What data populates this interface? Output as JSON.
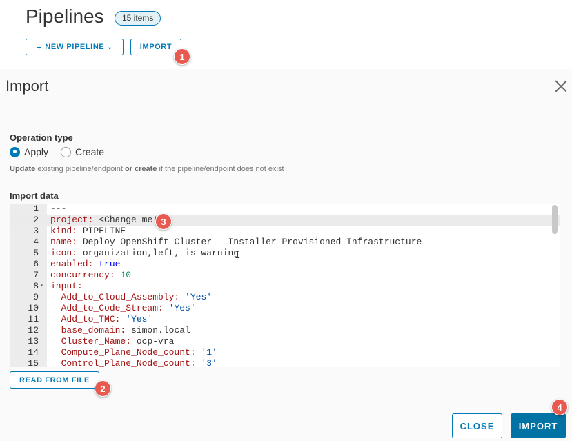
{
  "header": {
    "title": "Pipelines",
    "count_badge": "15 items",
    "new_pipeline_label": "NEW PIPELINE",
    "import_label": "IMPORT"
  },
  "callouts": [
    "1",
    "2",
    "3",
    "4"
  ],
  "modal": {
    "title": "Import",
    "operation_type_label": "Operation type",
    "options": [
      {
        "label": "Apply",
        "selected": true
      },
      {
        "label": "Create",
        "selected": false
      }
    ],
    "helper": {
      "part1": "Update",
      "part2": " existing pipeline/endpoint ",
      "part3": "or create",
      "part4": " if the pipeline/endpoint does not exist"
    },
    "import_data_label": "Import data",
    "editor": {
      "active_line": 2,
      "lines": [
        {
          "n": "1",
          "key": "---",
          "sep": "",
          "val": ""
        },
        {
          "n": "2",
          "key": "project:",
          "sep": " ",
          "val": "<Change me!>"
        },
        {
          "n": "3",
          "key": "kind:",
          "sep": " ",
          "val": "PIPELINE"
        },
        {
          "n": "4",
          "key": "name:",
          "sep": " ",
          "val": "Deploy OpenShift Cluster - Installer Provisioned Infrastructure"
        },
        {
          "n": "5",
          "key": "icon:",
          "sep": " ",
          "val": "organization,left, is-warning"
        },
        {
          "n": "6",
          "key": "enabled:",
          "sep": " ",
          "val": "true"
        },
        {
          "n": "7",
          "key": "concurrency:",
          "sep": " ",
          "val": "10"
        },
        {
          "n": "8",
          "key": "input:",
          "sep": "",
          "val": ""
        },
        {
          "n": "9",
          "key": "  Add_to_Cloud_Assembly:",
          "sep": " ",
          "val": "'Yes'"
        },
        {
          "n": "10",
          "key": "  Add_to_Code_Stream:",
          "sep": " ",
          "val": "'Yes'"
        },
        {
          "n": "11",
          "key": "  Add_to_TMC:",
          "sep": " ",
          "val": "'Yes'"
        },
        {
          "n": "12",
          "key": "  base_domain:",
          "sep": " ",
          "val": "simon.local"
        },
        {
          "n": "13",
          "key": "  Cluster_Name:",
          "sep": " ",
          "val": "ocp-vra"
        },
        {
          "n": "14",
          "key": "  Compute_Plane_Node_count:",
          "sep": " ",
          "val": "'1'"
        },
        {
          "n": "15",
          "key": "  Control_Plane_Node_count:",
          "sep": " ",
          "val": "'3'"
        }
      ]
    },
    "read_from_file_label": "READ FROM FILE",
    "close_label": "CLOSE",
    "import_label": "IMPORT"
  }
}
